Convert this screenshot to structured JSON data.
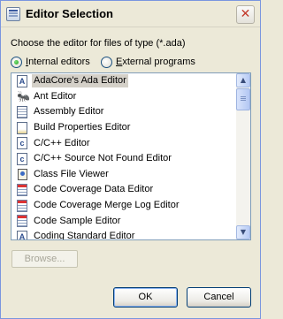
{
  "window": {
    "title": "Editor Selection",
    "close_glyph": "✕"
  },
  "prompt": "Choose the editor for files of type (*.ada)",
  "radios": {
    "internal": {
      "label_accel": "I",
      "label_rest": "nternal editors",
      "checked": true
    },
    "external": {
      "label_accel": "E",
      "label_rest": "xternal programs",
      "checked": false
    }
  },
  "editors": [
    {
      "label": "AdaCore's Ada Editor",
      "icon": "ada-letter-icon",
      "glyph": "A",
      "selected": true
    },
    {
      "label": "Ant Editor",
      "icon": "ant-bug-icon",
      "glyph": "🐜",
      "selected": false
    },
    {
      "label": "Assembly Editor",
      "icon": "assembly-document-icon",
      "glyph": "",
      "selected": false
    },
    {
      "label": "Build Properties Editor",
      "icon": "properties-file-icon",
      "glyph": "",
      "selected": false
    },
    {
      "label": "C/C++ Editor",
      "icon": "c-file-icon",
      "glyph": "c",
      "selected": false
    },
    {
      "label": "C/C++ Source Not Found Editor",
      "icon": "c-file-icon",
      "glyph": "c",
      "selected": false
    },
    {
      "label": "Class File Viewer",
      "icon": "class-file-icon",
      "glyph": "",
      "selected": false
    },
    {
      "label": "Code Coverage Data Editor",
      "icon": "coverage-grid-icon",
      "glyph": "",
      "selected": false
    },
    {
      "label": "Code Coverage Merge Log Editor",
      "icon": "coverage-grid-icon",
      "glyph": "",
      "selected": false
    },
    {
      "label": "Code Sample Editor",
      "icon": "code-sample-icon",
      "glyph": "",
      "selected": false
    },
    {
      "label": "Coding Standard Editor",
      "icon": "coding-standard-icon",
      "glyph": "A",
      "selected": false
    }
  ],
  "scrollbar": {
    "up_glyph": "▲",
    "down_glyph": "▼"
  },
  "buttons": {
    "browse": "Browse...",
    "ok": "OK",
    "cancel": "Cancel"
  }
}
